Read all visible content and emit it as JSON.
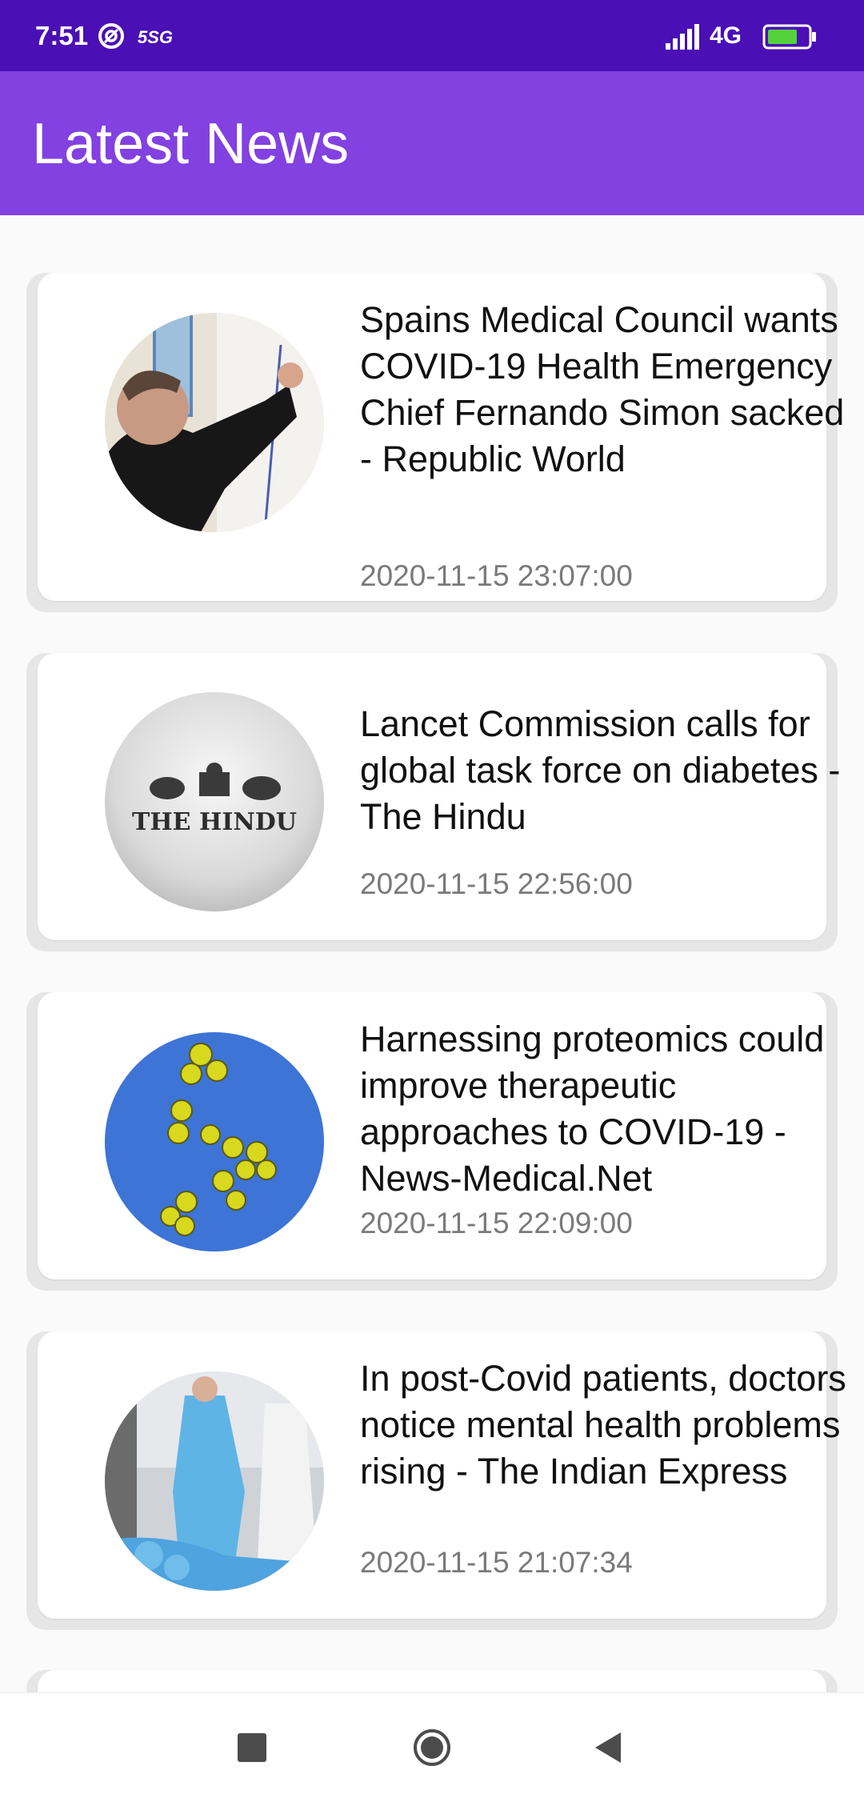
{
  "status_bar": {
    "time": "7:51",
    "carrier_badge": "5SG",
    "network": "4G",
    "battery": "67",
    "icons": [
      "at-icon",
      "signal-icon",
      "battery-icon"
    ]
  },
  "app_bar": {
    "title": "Latest News",
    "color": "#8241e0"
  },
  "news": [
    {
      "headline": "Spains Medical Council wants COVID-19 Health Emergency Chief Fernando Simon sacked - Republic World",
      "date": "2020-11-15 23:07:00",
      "image": "man-at-whiteboard"
    },
    {
      "headline": "Lancet Commission calls for global task force on diabetes - The Hindu",
      "date": "2020-11-15 22:56:00",
      "image": "the-hindu-logo",
      "logo_text": "THE HINDU"
    },
    {
      "headline": "Harnessing proteomics could improve therapeutic approaches to COVID-19 - News-Medical.Net",
      "date": "2020-11-15 22:09:00",
      "image": "virus-particles"
    },
    {
      "headline": "In post-Covid patients, doctors notice mental health problems rising - The Indian Express",
      "date": "2020-11-15 21:07:34",
      "image": "health-workers-ppe"
    }
  ],
  "nav_bar": {
    "icons": [
      "recents-icon",
      "home-icon",
      "back-icon"
    ]
  }
}
